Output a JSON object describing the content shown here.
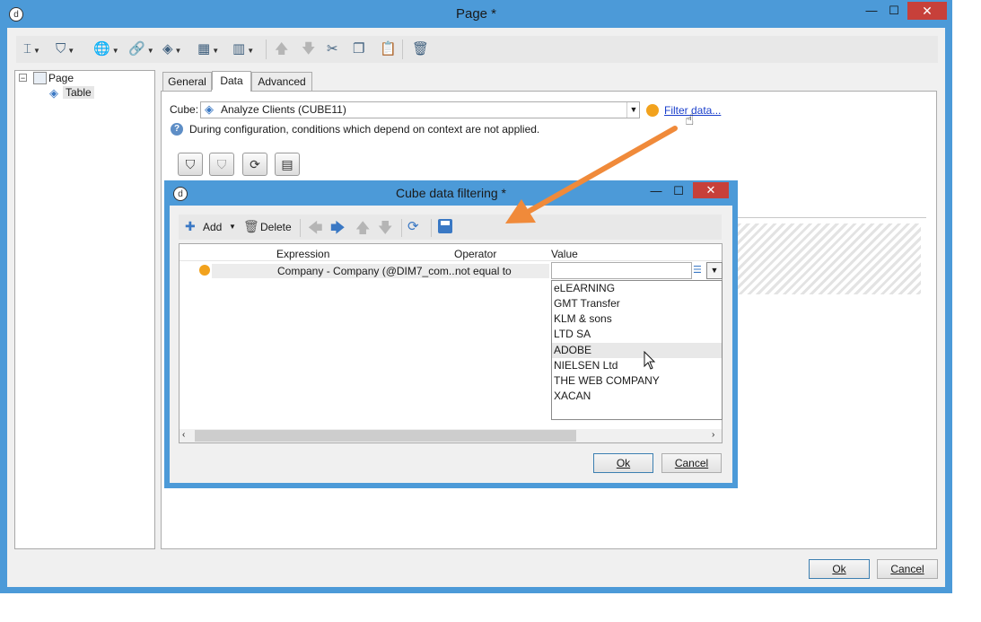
{
  "main_window": {
    "title": "Page *",
    "tree": {
      "root": "Page",
      "child": "Table"
    },
    "tabs": [
      "General",
      "Data",
      "Advanced"
    ],
    "active_tab": "Data",
    "cube_label": "Cube:",
    "cube_value": "Analyze Clients (CUBE11)",
    "filter_link": "Filter data...",
    "info_text": "During configuration, conditions which depend on context are not applied.",
    "ok": "Ok",
    "cancel": "Cancel"
  },
  "dialog": {
    "title": "Cube data filtering *",
    "add": "Add",
    "delete": "Delete",
    "columns": [
      "Expression",
      "Operator",
      "Value"
    ],
    "row": {
      "expression": "Company - Company (@DIM7_com...",
      "operator": "not equal to",
      "value": ""
    },
    "options": [
      "eLEARNING",
      "GMT Transfer",
      "KLM & sons",
      "LTD SA",
      "ADOBE",
      "NIELSEN Ltd",
      "THE WEB COMPANY",
      "XACAN"
    ],
    "highlighted_option": "ADOBE",
    "ok": "Ok",
    "cancel": "Cancel"
  },
  "colors": {
    "title_bar": "#4c9ad8",
    "close": "#c7403a",
    "status_dot": "#f2a21d",
    "arrow": "#f08a3a",
    "link": "#1a3fcc"
  }
}
